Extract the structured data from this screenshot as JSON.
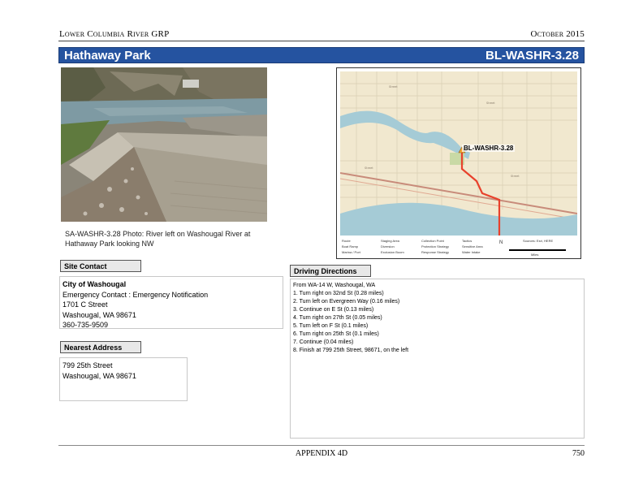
{
  "header": {
    "left": "Lower Columbia River GRP",
    "right": "October 2015"
  },
  "title_bar": {
    "name": "Hathaway Park",
    "code": "BL-WASHR-3.28"
  },
  "photo": {
    "caption_line1": "SA-WASHR-3.28 Photo: River left on Washougal River at",
    "caption_line2": "Hathaway Park looking NW"
  },
  "map": {
    "site_label": "BL-WASHR-3.28",
    "legend": {
      "col1": [
        "Route",
        "Boat Ramp",
        "Marina / Port"
      ],
      "col2": [
        "Staging Area",
        "Diversion",
        "Exclusion Boom"
      ],
      "col3": [
        "Collection Point",
        "Protection Strategy",
        "Response Strategy"
      ],
      "col4": [
        "Tactics",
        "Sensitive Area",
        "Water Intake"
      ],
      "north": "N",
      "scale_label": "Miles",
      "sources": "Sources: Esri, HERE"
    }
  },
  "site_contact": {
    "label": "Site Contact",
    "org": "City of Washougal",
    "line1": "Emergency Contact : Emergency Notification",
    "line2": "1701 C Street",
    "line3": "Washougal, WA  98671",
    "line4": "360-735-9509"
  },
  "nearest_address": {
    "label": "Nearest Address",
    "line1": "799 25th Street",
    "line2": "Washougal, WA  98671"
  },
  "driving_directions": {
    "label": "Driving Directions",
    "lines": [
      "From WA-14 W, Washougal, WA",
      "1. Turn right on 32nd St (0.28 miles)",
      "2. Turn left on Evergreen Way (0.16 miles)",
      "3. Continue on E St (0.13 miles)",
      "4. Turn right on 27th St (0.05 miles)",
      "5. Turn left on F St (0.1 miles)",
      "6. Turn right on 25th St (0.1 miles)",
      "7. Continue (0.04 miles)",
      "8. Finish at 799 25th Street, 98671, on the left"
    ]
  },
  "footer": {
    "center": "APPENDIX 4D",
    "page": "750"
  }
}
